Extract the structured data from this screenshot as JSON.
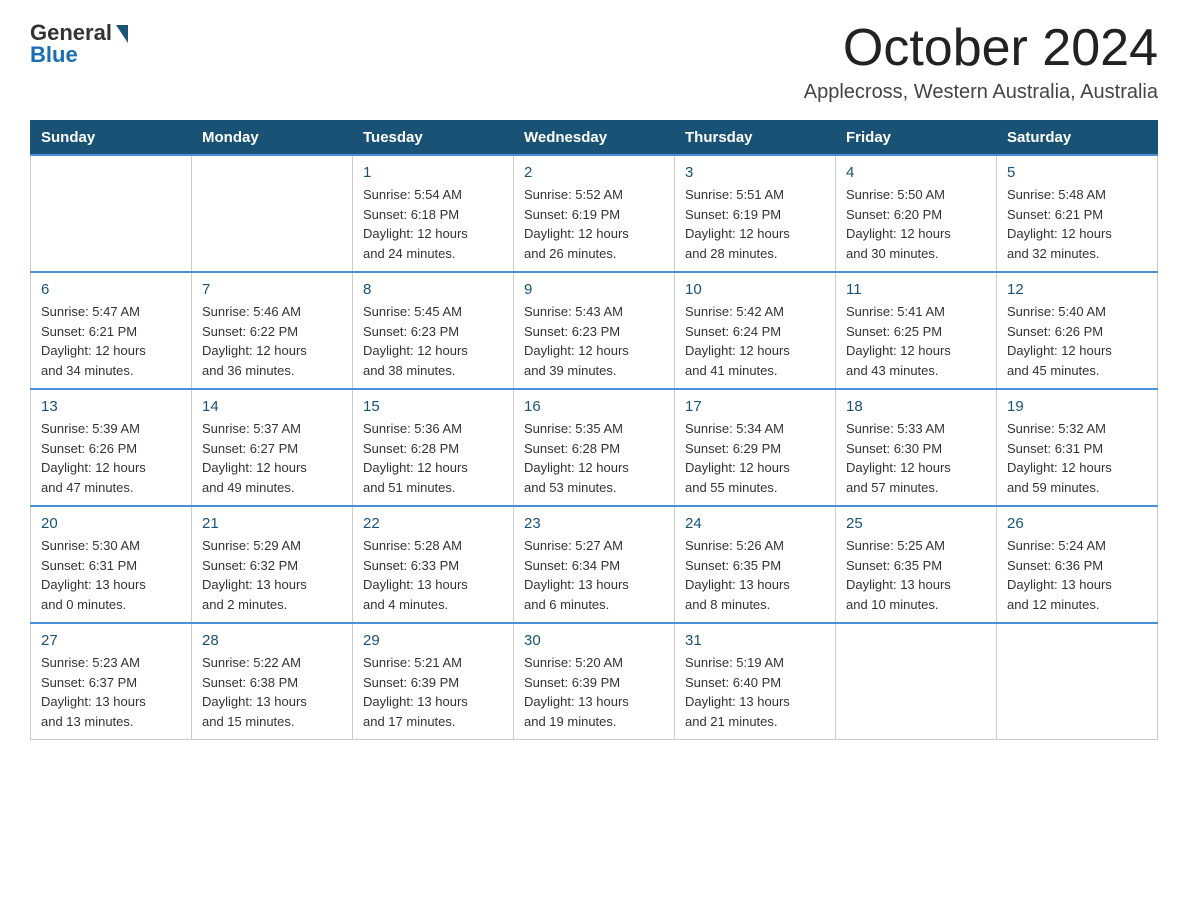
{
  "logo": {
    "general": "General",
    "blue": "Blue"
  },
  "header": {
    "month": "October 2024",
    "location": "Applecross, Western Australia, Australia"
  },
  "weekdays": [
    "Sunday",
    "Monday",
    "Tuesday",
    "Wednesday",
    "Thursday",
    "Friday",
    "Saturday"
  ],
  "weeks": [
    [
      {
        "day": "",
        "info": ""
      },
      {
        "day": "",
        "info": ""
      },
      {
        "day": "1",
        "info": "Sunrise: 5:54 AM\nSunset: 6:18 PM\nDaylight: 12 hours\nand 24 minutes."
      },
      {
        "day": "2",
        "info": "Sunrise: 5:52 AM\nSunset: 6:19 PM\nDaylight: 12 hours\nand 26 minutes."
      },
      {
        "day": "3",
        "info": "Sunrise: 5:51 AM\nSunset: 6:19 PM\nDaylight: 12 hours\nand 28 minutes."
      },
      {
        "day": "4",
        "info": "Sunrise: 5:50 AM\nSunset: 6:20 PM\nDaylight: 12 hours\nand 30 minutes."
      },
      {
        "day": "5",
        "info": "Sunrise: 5:48 AM\nSunset: 6:21 PM\nDaylight: 12 hours\nand 32 minutes."
      }
    ],
    [
      {
        "day": "6",
        "info": "Sunrise: 5:47 AM\nSunset: 6:21 PM\nDaylight: 12 hours\nand 34 minutes."
      },
      {
        "day": "7",
        "info": "Sunrise: 5:46 AM\nSunset: 6:22 PM\nDaylight: 12 hours\nand 36 minutes."
      },
      {
        "day": "8",
        "info": "Sunrise: 5:45 AM\nSunset: 6:23 PM\nDaylight: 12 hours\nand 38 minutes."
      },
      {
        "day": "9",
        "info": "Sunrise: 5:43 AM\nSunset: 6:23 PM\nDaylight: 12 hours\nand 39 minutes."
      },
      {
        "day": "10",
        "info": "Sunrise: 5:42 AM\nSunset: 6:24 PM\nDaylight: 12 hours\nand 41 minutes."
      },
      {
        "day": "11",
        "info": "Sunrise: 5:41 AM\nSunset: 6:25 PM\nDaylight: 12 hours\nand 43 minutes."
      },
      {
        "day": "12",
        "info": "Sunrise: 5:40 AM\nSunset: 6:26 PM\nDaylight: 12 hours\nand 45 minutes."
      }
    ],
    [
      {
        "day": "13",
        "info": "Sunrise: 5:39 AM\nSunset: 6:26 PM\nDaylight: 12 hours\nand 47 minutes."
      },
      {
        "day": "14",
        "info": "Sunrise: 5:37 AM\nSunset: 6:27 PM\nDaylight: 12 hours\nand 49 minutes."
      },
      {
        "day": "15",
        "info": "Sunrise: 5:36 AM\nSunset: 6:28 PM\nDaylight: 12 hours\nand 51 minutes."
      },
      {
        "day": "16",
        "info": "Sunrise: 5:35 AM\nSunset: 6:28 PM\nDaylight: 12 hours\nand 53 minutes."
      },
      {
        "day": "17",
        "info": "Sunrise: 5:34 AM\nSunset: 6:29 PM\nDaylight: 12 hours\nand 55 minutes."
      },
      {
        "day": "18",
        "info": "Sunrise: 5:33 AM\nSunset: 6:30 PM\nDaylight: 12 hours\nand 57 minutes."
      },
      {
        "day": "19",
        "info": "Sunrise: 5:32 AM\nSunset: 6:31 PM\nDaylight: 12 hours\nand 59 minutes."
      }
    ],
    [
      {
        "day": "20",
        "info": "Sunrise: 5:30 AM\nSunset: 6:31 PM\nDaylight: 13 hours\nand 0 minutes."
      },
      {
        "day": "21",
        "info": "Sunrise: 5:29 AM\nSunset: 6:32 PM\nDaylight: 13 hours\nand 2 minutes."
      },
      {
        "day": "22",
        "info": "Sunrise: 5:28 AM\nSunset: 6:33 PM\nDaylight: 13 hours\nand 4 minutes."
      },
      {
        "day": "23",
        "info": "Sunrise: 5:27 AM\nSunset: 6:34 PM\nDaylight: 13 hours\nand 6 minutes."
      },
      {
        "day": "24",
        "info": "Sunrise: 5:26 AM\nSunset: 6:35 PM\nDaylight: 13 hours\nand 8 minutes."
      },
      {
        "day": "25",
        "info": "Sunrise: 5:25 AM\nSunset: 6:35 PM\nDaylight: 13 hours\nand 10 minutes."
      },
      {
        "day": "26",
        "info": "Sunrise: 5:24 AM\nSunset: 6:36 PM\nDaylight: 13 hours\nand 12 minutes."
      }
    ],
    [
      {
        "day": "27",
        "info": "Sunrise: 5:23 AM\nSunset: 6:37 PM\nDaylight: 13 hours\nand 13 minutes."
      },
      {
        "day": "28",
        "info": "Sunrise: 5:22 AM\nSunset: 6:38 PM\nDaylight: 13 hours\nand 15 minutes."
      },
      {
        "day": "29",
        "info": "Sunrise: 5:21 AM\nSunset: 6:39 PM\nDaylight: 13 hours\nand 17 minutes."
      },
      {
        "day": "30",
        "info": "Sunrise: 5:20 AM\nSunset: 6:39 PM\nDaylight: 13 hours\nand 19 minutes."
      },
      {
        "day": "31",
        "info": "Sunrise: 5:19 AM\nSunset: 6:40 PM\nDaylight: 13 hours\nand 21 minutes."
      },
      {
        "day": "",
        "info": ""
      },
      {
        "day": "",
        "info": ""
      }
    ]
  ]
}
